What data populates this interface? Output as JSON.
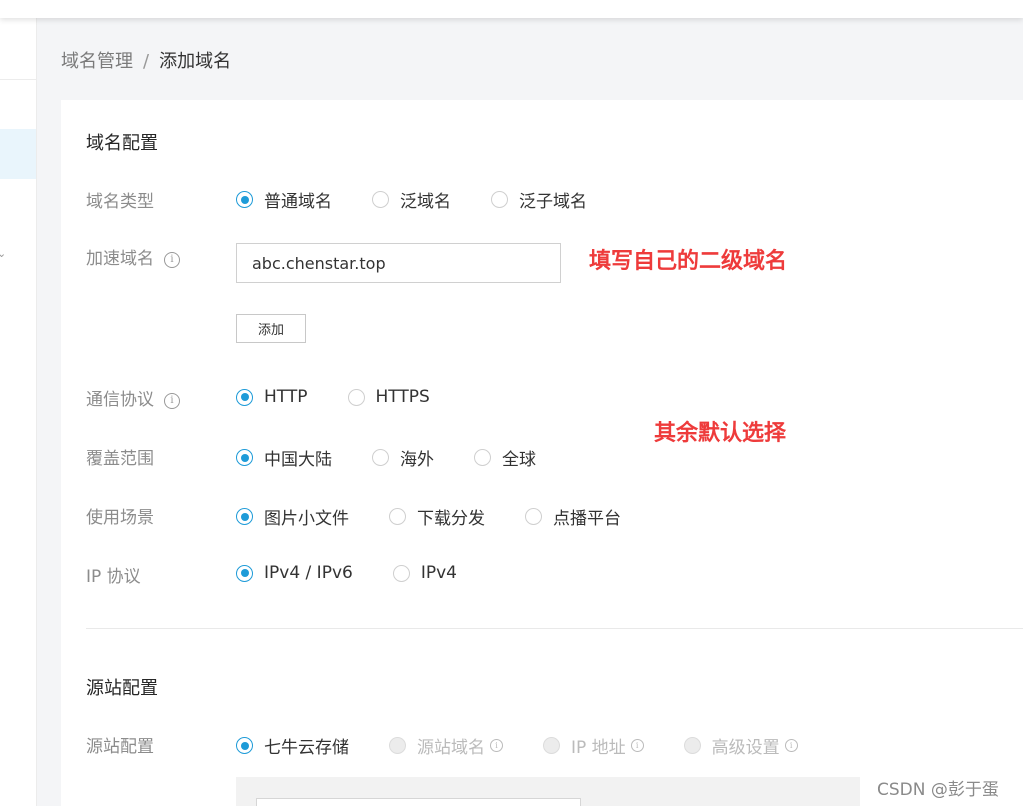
{
  "breadcrumb": {
    "parent": "域名管理",
    "separator": "/",
    "current": "添加域名"
  },
  "domain_config": {
    "title": "域名配置",
    "domain_type": {
      "label": "域名类型",
      "options": [
        "普通域名",
        "泛域名",
        "泛子域名"
      ],
      "selected": "普通域名"
    },
    "accel_domain": {
      "label": "加速域名",
      "info_icon": "i",
      "value": "abc.chenstar.top",
      "add_button": "添加"
    },
    "protocol": {
      "label": "通信协议",
      "info_icon": "i",
      "options": [
        "HTTP",
        "HTTPS"
      ],
      "selected": "HTTP"
    },
    "coverage": {
      "label": "覆盖范围",
      "options": [
        "中国大陆",
        "海外",
        "全球"
      ],
      "selected": "中国大陆"
    },
    "scenario": {
      "label": "使用场景",
      "options": [
        "图片小文件",
        "下载分发",
        "点播平台"
      ],
      "selected": "图片小文件"
    },
    "ip_protocol": {
      "label": "IP 协议",
      "options": [
        "IPv4 / IPv6",
        "IPv4"
      ],
      "selected": "IPv4 / IPv6"
    }
  },
  "origin_config": {
    "title": "源站配置",
    "label": "源站配置",
    "options": [
      "七牛云存储",
      "源站域名",
      "IP 地址",
      "高级设置"
    ],
    "selected": "七牛云存储",
    "disabled": [
      "源站域名",
      "IP 地址",
      "高级设置"
    ],
    "info_icon": "i"
  },
  "annotations": {
    "fill_domain": "填写自己的二级域名",
    "default_select": "其余默认选择"
  },
  "sidebar": {
    "chevron": "⌄"
  },
  "watermark": "CSDN @彭于蛋",
  "colors": {
    "accent": "#1e9bd8",
    "annotation": "#ee3b3b"
  }
}
